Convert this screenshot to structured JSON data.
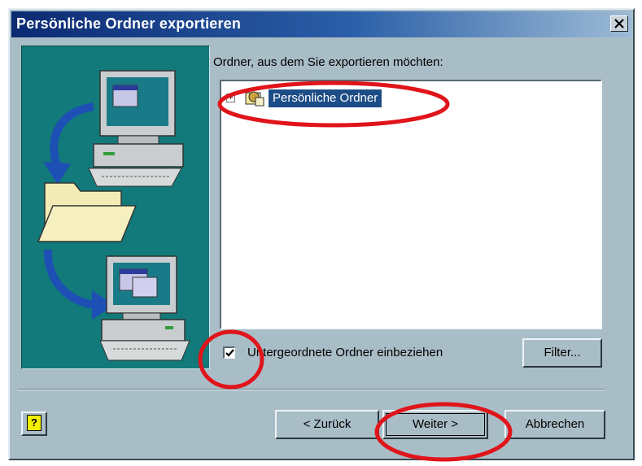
{
  "window": {
    "title": "Persönliche Ordner exportieren",
    "close_icon": "close-icon"
  },
  "main": {
    "folder_label": "Ordner, aus dem Sie exportieren möchten:",
    "tree": [
      {
        "label": "Persönliche Ordner",
        "expander": "+",
        "icon": "personal-folders-icon",
        "selected": true
      }
    ],
    "include_subfolders": {
      "label": "Untergeordnete Ordner einbeziehen",
      "checked": true
    },
    "filter_button": "Filter..."
  },
  "footer": {
    "help_button": "?",
    "back_button": "< Zurück",
    "next_button": "Weiter >",
    "cancel_button": "Abbrechen"
  },
  "colors": {
    "dialog_face": "#a9bdc7",
    "illustration_bg": "#127a7a",
    "title_gradient_start": "#0b2a73",
    "selection": "#1d4d86",
    "annotation": "#e0141a"
  }
}
